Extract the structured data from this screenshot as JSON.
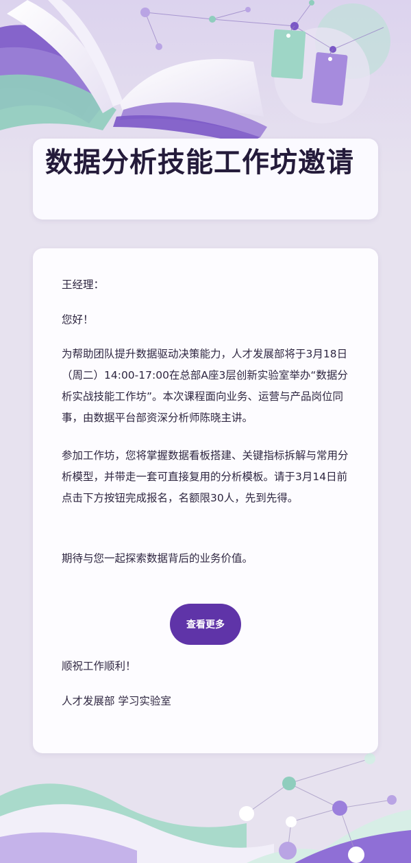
{
  "header": {
    "title": "数据分析技能工作坊邀请"
  },
  "letter": {
    "salutation": "王经理：",
    "greeting": "您好！",
    "paragraph_1": "为帮助团队提升数据驱动决策能力，人才发展部将于3月18日（周二）14:00-17:00在总部A座3层创新实验室举办“数据分析实战技能工作坊”。本次课程面向业务、运营与产品岗位同事，由数据平台部资深分析师陈晓主讲。",
    "paragraph_2": "参加工作坊，您将掌握数据看板搭建、关键指标拆解与常用分析模型，并带走一套可直接复用的分析模板。请于3月14日前点击下方按钮完成报名，名额限30人，先到先得。",
    "paragraph_3": "期待与您一起探索数据背后的业务价值。",
    "cta_label": "查看更多",
    "closing": "顺祝工作顺利！",
    "signature": "人才发展部 学习实验室"
  },
  "colors": {
    "accent": "#5f34a8",
    "background": "#e7e2ef",
    "card": "#fdfcff",
    "text": "#2e2640"
  }
}
